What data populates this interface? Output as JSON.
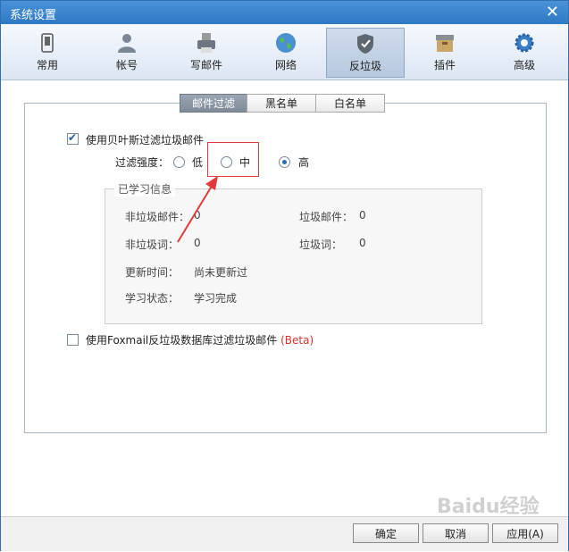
{
  "window": {
    "title": "系统设置"
  },
  "toolbar": {
    "items": [
      {
        "label": "常用",
        "icon": "phone-icon"
      },
      {
        "label": "帐号",
        "icon": "user-icon"
      },
      {
        "label": "写邮件",
        "icon": "printer-icon"
      },
      {
        "label": "网络",
        "icon": "globe-icon"
      },
      {
        "label": "反垃圾",
        "icon": "shield-icon",
        "active": true
      },
      {
        "label": "插件",
        "icon": "box-icon"
      },
      {
        "label": "高级",
        "icon": "gear-icon"
      }
    ]
  },
  "tabs": [
    {
      "label": "邮件过滤",
      "active": true
    },
    {
      "label": "黑名单"
    },
    {
      "label": "白名单"
    }
  ],
  "filter": {
    "bayes_label": "使用贝叶斯过滤垃圾邮件",
    "bayes_checked": true,
    "strength_label": "过滤强度：",
    "options": [
      "低",
      "中",
      "高"
    ],
    "selected": "高"
  },
  "learned": {
    "title": "已学习信息",
    "non_spam_mail_label": "非垃圾邮件：",
    "non_spam_mail_value": "0",
    "spam_mail_label": "垃圾邮件：",
    "spam_mail_value": "0",
    "non_spam_word_label": "非垃圾词：",
    "non_spam_word_value": "0",
    "spam_word_label": "垃圾词：",
    "spam_word_value": "0",
    "update_time_label": "更新时间：",
    "update_time_value": "尚未更新过",
    "learn_status_label": "学习状态：",
    "learn_status_value": "学习完成"
  },
  "foxmail_db": {
    "label": "使用Foxmail反垃圾数据库过滤垃圾邮件",
    "beta": "(Beta)",
    "checked": false
  },
  "buttons": {
    "ok": "确定",
    "cancel": "取消",
    "apply": "应用(A)"
  },
  "watermark": "Baidu经验",
  "colors": {
    "accent": "#2e79c4",
    "annotation": "#e23b3b",
    "beta": "#d9302a"
  }
}
